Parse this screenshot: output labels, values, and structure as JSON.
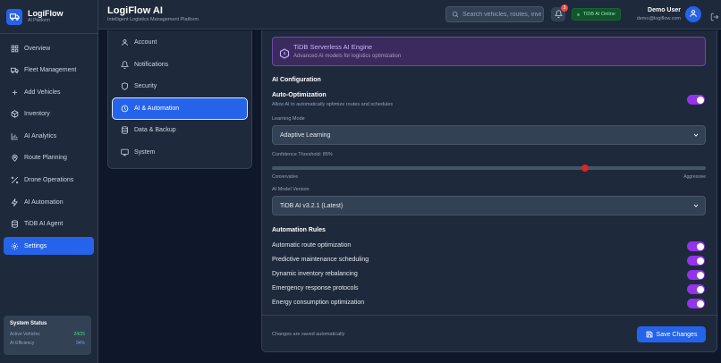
{
  "brand": {
    "name": "LogiFlow",
    "sub": "AI Platform"
  },
  "nav": [
    {
      "label": "Overview",
      "icon": "grid-icon"
    },
    {
      "label": "Fleet Management",
      "icon": "truck-icon"
    },
    {
      "label": "Add Vehicles",
      "icon": "plus-icon"
    },
    {
      "label": "Inventory",
      "icon": "box-icon"
    },
    {
      "label": "AI Analytics",
      "icon": "chart-icon"
    },
    {
      "label": "Route Planning",
      "icon": "pin-icon"
    },
    {
      "label": "Drone Operations",
      "icon": "drone-icon"
    },
    {
      "label": "AI Automation",
      "icon": "zap-icon"
    },
    {
      "label": "TiDB AI Agent",
      "icon": "database-icon"
    },
    {
      "label": "Settings",
      "icon": "gear-icon",
      "active": true
    }
  ],
  "system_status": {
    "title": "System Status",
    "rows": [
      {
        "label": "Active Vehicles",
        "value": "24/25"
      },
      {
        "label": "AI Efficiency",
        "value": "94%"
      }
    ]
  },
  "header": {
    "title": "LogiFlow AI",
    "subtitle": "Intelligent Logistics Management Platform",
    "search_placeholder": "Search vehicles, routes, inventory...",
    "notif_count": "3",
    "ai_status": "TiDB AI Online",
    "user_name": "Demo User",
    "user_email": "demo@logiflow.com"
  },
  "settings_menu": [
    {
      "label": "Account",
      "icon": "user-icon"
    },
    {
      "label": "Notifications",
      "icon": "bell-icon"
    },
    {
      "label": "Security",
      "icon": "shield-icon"
    },
    {
      "label": "AI & Automation",
      "icon": "ai-icon",
      "active": true
    },
    {
      "label": "Data & Backup",
      "icon": "database-icon"
    },
    {
      "label": "System",
      "icon": "monitor-icon"
    }
  ],
  "engine": {
    "title": "TiDB Serverless AI Engine",
    "subtitle": "Advanced AI models for logistics optimization"
  },
  "ai_config": {
    "section_title": "AI Configuration",
    "auto_opt_label": "Auto-Optimization",
    "auto_opt_desc": "Allow AI to automatically optimize routes and schedules",
    "auto_opt_enabled": true,
    "learning_mode_label": "Learning Mode",
    "learning_mode_value": "Adaptive Learning",
    "confidence_label": "Confidence Threshold: 85%",
    "confidence_value": 85,
    "confidence_min_label": "Conservative",
    "confidence_max_label": "Aggressive",
    "model_version_label": "AI Model Version",
    "model_version_value": "TiDB AI v3.2.1 (Latest)"
  },
  "automation": {
    "section_title": "Automation Rules",
    "rules": [
      {
        "label": "Automatic route optimization",
        "enabled": true
      },
      {
        "label": "Predictive maintenance scheduling",
        "enabled": true
      },
      {
        "label": "Dynamic inventory rebalancing",
        "enabled": true
      },
      {
        "label": "Emergency response protocols",
        "enabled": true
      },
      {
        "label": "Energy consumption optimization",
        "enabled": true
      }
    ]
  },
  "footer": {
    "auto_save_note": "Changes are saved automatically",
    "save_label": "Save Changes"
  },
  "colors": {
    "primary": "#2563eb",
    "toggle_on": "#9333ea",
    "slider_thumb": "#dc2626",
    "status_online": "#22c55e"
  }
}
